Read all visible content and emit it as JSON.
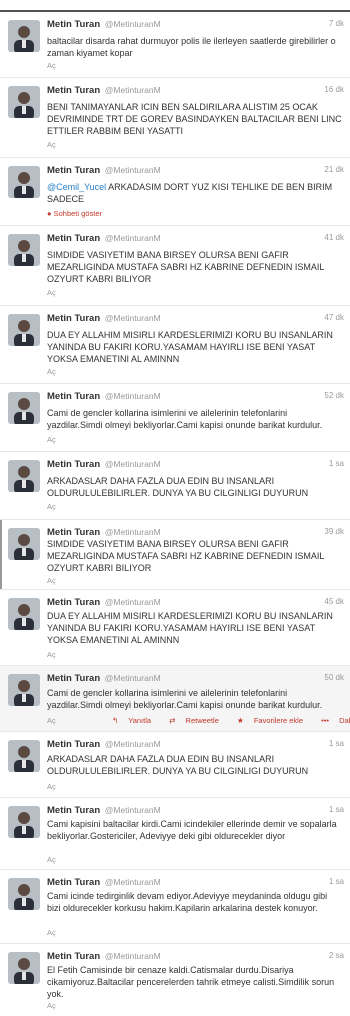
{
  "author": {
    "name": "Metin Turan",
    "handle": "@MetinturanM"
  },
  "tweets": [
    {
      "time": "7 dk",
      "text": "baltacilar disarda rahat durmuyor polis ile ilerleyen saatlerde girebilirler o zaman kiyamet kopar",
      "footer": "Aç"
    },
    {
      "time": "16 dk",
      "text": "BENI TANIMAYANLAR ICIN BEN SALDIRILARA ALISTIM 25 OCAK DEVRIMINDE TRT DE GOREV BASINDAYKEN BALTACILAR BENI LINC ETTILER RABBIM BENI YASATTI",
      "footer": "Aç"
    },
    {
      "time": "21 dk",
      "mention": "@Cemil_Yucel",
      "text": " ARKADASIM DORT YUZ KISI TEHLIKE DE BEN BIRIM SADECE",
      "footer": "Sohbeti göster"
    },
    {
      "time": "41 dk",
      "text": "SIMDIDE VASIYETIM BANA BIRSEY OLURSA BENI GAFIR MEZARLIGINDA MUSTAFA SABRI HZ KABRINE DEFNEDIN ISMAIL OZYURT KABRI BILIYOR",
      "footer": "Aç"
    },
    {
      "time": "47 dk",
      "text": "DUA EY ALLAHIM MISIRLI KARDESLERIMIZI KORU BU INSANLARIN YANINDA BU FAKIRI KORU.YASAMAM HAYIRLI ISE BENI YASAT YOKSA EMANETINI AL AMINNN",
      "footer": "Aç"
    },
    {
      "time": "52 dk",
      "text": "Cami de gencler kollarina isimlerini ve ailelerinin telefonlarini yazdilar.Simdi olmeyi bekliyorlar.Cami kapisi onunde barikat kurdulur.",
      "footer": "Aç"
    },
    {
      "time": "1 sa",
      "text": "ARKADASLAR DAHA FAZLA DUA EDIN BU INSANLARI OLDURULULEBILIRLER. DUNYA YA BU CILGINLIGI DUYURUN",
      "footer": "Aç"
    },
    {
      "time": "39 dk",
      "text": "SIMDIDE VASIYETIM BANA BIRSEY OLURSA BENI GAFIR MEZARLIGINDA MUSTAFA SABRI HZ KABRINE DEFNEDIN ISMAIL OZYURT KABRI BILIYOR",
      "footer": "Aç"
    },
    {
      "time": "45 dk",
      "text": "DUA EY ALLAHIM MISIRLI KARDESLERIMIZI KORU BU INSANLARIN YANINDA BU FAKIRI KORU.YASAMAM HAYIRLI ISE BENI YASAT YOKSA EMANETINI AL AMINNN",
      "footer": "Aç"
    },
    {
      "time": "50 dk",
      "text": "Cami de gencler kollarina isimlerini ve ailelerinin telefonlarini yazdilar.Simdi olmeyi bekliyorlar.Cami kapisi onunde barikat kurdulur.",
      "footer": "Aç",
      "actions": {
        "reply": "Yanıtla",
        "retweet": "Retweetle",
        "favorite": "Favorilere ekle",
        "more": "Daha fazla"
      }
    },
    {
      "time": "1 sa",
      "text": "ARKADASLAR DAHA FAZLA DUA EDIN BU INSANLARI OLDURULULEBILIRLER. DUNYA YA BU CILGINLIGI DUYURUN",
      "footer": "Aç"
    },
    {
      "time": "1 sa",
      "text": "Cami kapisini baltacilar kirdi.Cami icindekiler ellerinde demir ve sopalarla bekliyorlar.Gostericiler, Adeviyye deki gibi oldurecekler diyor",
      "footer": "Aç"
    },
    {
      "time": "1 sa",
      "text": "Cami icinde tedirginlik devam ediyor.Adeviyye meydaninda oldugu gibi bizi oldurecekler korkusu hakim.Kapilarin arkalarina destek konuyor.",
      "footer": "Aç"
    },
    {
      "time": "2 sa",
      "text": "El Fetih Camisinde bir cenaze kaldi.Catismalar durdu.Disariya cikamiyoruz.Baltacilar pencerelerden tahrik etmeye calisti.Simdilik sorun yok.",
      "footer": "Aç"
    }
  ],
  "colors": {
    "link": "#2a7fc6",
    "action": "#c0392b",
    "muted": "#999999"
  }
}
